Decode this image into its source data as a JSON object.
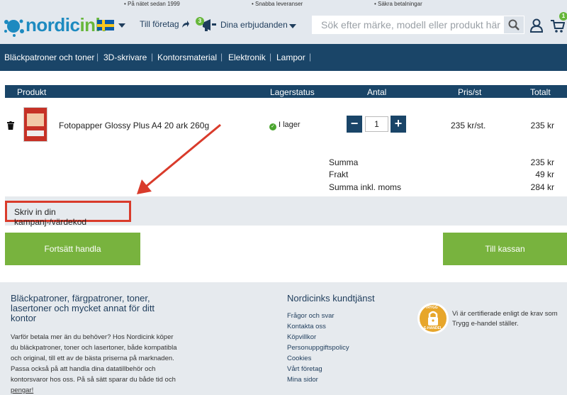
{
  "topbar": {
    "usp1": "• På nätet sedan 1999",
    "usp2": "• Snabba leveranser",
    "usp3": "• Säkra betalningar"
  },
  "header": {
    "logo_part1": "nordic",
    "logo_part2": "ink",
    "business_link": "Till företag",
    "offers_badge": "3",
    "offers_link": "Dina erbjudanden",
    "search_placeholder": "Sök efter märke, modell eller produkt här",
    "cart_badge": "1"
  },
  "nav": {
    "items": [
      "Bläckpatroner och toner",
      "3D-skrivare",
      "Kontorsmaterial",
      "Elektronik",
      "Lampor"
    ]
  },
  "cart": {
    "headers": {
      "product": "Produkt",
      "stock": "Lagerstatus",
      "qty": "Antal",
      "unit_price": "Pris/st",
      "total": "Totalt"
    },
    "items": [
      {
        "name": "Fotopapper Glossy Plus A4 20 ark 260g",
        "stock": "I lager",
        "quantity": "1",
        "unit_price": "235 kr/st.",
        "total": "235 kr"
      }
    ],
    "summary": [
      {
        "label": "Summa",
        "value": "235 kr"
      },
      {
        "label": "Frakt",
        "value": "49 kr"
      },
      {
        "label": "Summa inkl. moms",
        "value": "284 kr"
      }
    ],
    "promo_label": "Skriv in din kampanj-/värdekod",
    "continue_button": "Fortsätt handla",
    "checkout_button": "Till kassan"
  },
  "footer": {
    "about_heading": "Bläckpatroner, färgpatroner, toner, lasertoner och mycket annat för ditt kontor",
    "about_heading_lines": [
      "Bläckpatroner, färgpatroner, toner,",
      "lasertoner och mycket annat för ditt",
      "kontor"
    ],
    "about_text_lines": [
      "Varför betala mer än du behöver? Hos Nordicink köper",
      "du bläckpatroner, toner och lasertoner, både kompatibla",
      "och original, till ett av de bästa priserna på marknaden.",
      "Passa också på att handla dina datatillbehör och",
      "kontorsvaror hos oss. På så sätt sparar du både tid och",
      "pengar!"
    ],
    "service_heading": "Nordicinks kundtjänst",
    "service_links": [
      "Frågor och svar",
      "Kontakta oss",
      "Köpvillkor",
      "Personuppgiftspolicy",
      "Cookies",
      "Vårt företag",
      "Mina sidor"
    ],
    "trygg_badge_top": "TRYGG",
    "trygg_badge_bottom": "E-HANDEL",
    "trygg_text_lines": [
      "Vi är certifierade enligt de krav som",
      "Trygg e-handel ställer."
    ]
  },
  "colors": {
    "navy": "#1a4568",
    "green": "#78b33e",
    "annotation_red": "#d93b2b"
  }
}
